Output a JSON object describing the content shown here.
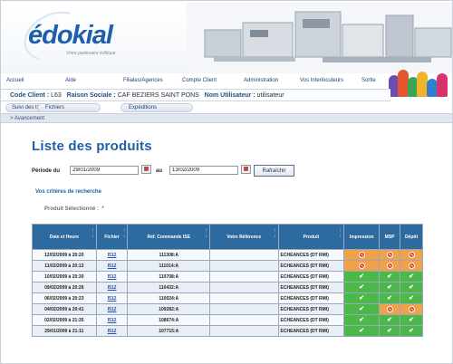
{
  "brand": {
    "logo": "édokial",
    "tagline": "Votre partenaire éditique",
    "accent": "#1f5ea8",
    "header_blue": "#2d6aa0",
    "ok_color": "#4db84a",
    "ko_color": "#f2a14b"
  },
  "menu": [
    "Accueil",
    "Aide",
    "Filiales/Agences",
    "Compte Client",
    "Administration",
    "Vos Interlocuteurs",
    "Sortie"
  ],
  "infobar": {
    "client_code_label": "Code Client :",
    "client_code": "L63",
    "company_label": "Raison Sociale :",
    "company": "CAF BEZIERS SAINT PONS",
    "user_label": "Nom Utilisateur :",
    "user": "utilisateur"
  },
  "subtabs": [
    "Suivi des travaux",
    "Fichiers",
    "Expéditions"
  ],
  "breadcrumb": "> Avancement",
  "page_title": "Liste des produits",
  "filter": {
    "period_label": "Période du",
    "from": "29/01/2009",
    "to_label": "au",
    "to": "13/02/2009",
    "refresh": "Rafraîchir"
  },
  "criteria_link": "Vos critères de recherche",
  "selected_label": "Produit Sélectionné :",
  "selected_value": "*",
  "table": {
    "headers": [
      "Date et Heure",
      "Fichier",
      "Réf. Commande ISE",
      "Votre Référence",
      "Produit",
      "Impression",
      "MSP",
      "Dépôt"
    ],
    "rows": [
      {
        "date": "12/02/2009 à 20:20",
        "file": "I512",
        "ref": "111308:A",
        "yours": "",
        "product": "ECHEANCES (DT RMI)",
        "status": [
          "ko",
          "ko",
          "ko"
        ]
      },
      {
        "date": "11/02/2009 à 20:13",
        "file": "I512",
        "ref": "111014:A",
        "yours": "",
        "product": "ECHEANCES (DT RMI)",
        "status": [
          "ko",
          "ko",
          "ko"
        ]
      },
      {
        "date": "10/02/2009 à 20:30",
        "file": "I512",
        "ref": "110708:A",
        "yours": "",
        "product": "ECHEANCES (DT RMI)",
        "status": [
          "ok",
          "ok",
          "ok"
        ]
      },
      {
        "date": "09/02/2009 à 20:26",
        "file": "I512",
        "ref": "110432:A",
        "yours": "",
        "product": "ECHEANCES (DT RMI)",
        "status": [
          "ok",
          "ok",
          "ok"
        ]
      },
      {
        "date": "06/02/2009 à 20:23",
        "file": "I512",
        "ref": "110024:A",
        "yours": "",
        "product": "ECHEANCES (DT RMI)",
        "status": [
          "ok",
          "ok",
          "ok"
        ]
      },
      {
        "date": "04/02/2009 à 20:41",
        "file": "I512",
        "ref": "109282:A",
        "yours": "",
        "product": "ECHEANCES (DT RMI)",
        "status": [
          "ok",
          "ko",
          "ko"
        ]
      },
      {
        "date": "02/02/2009 à 21:35",
        "file": "I512",
        "ref": "108674:A",
        "yours": "",
        "product": "ECHEANCES (DT RMI)",
        "status": [
          "ok",
          "ok",
          "ok"
        ]
      },
      {
        "date": "29/01/2009 à 21:11",
        "file": "I512",
        "ref": "107715:A",
        "yours": "",
        "product": "ECHEANCES (DT RMI)",
        "status": [
          "ok",
          "ok",
          "ok"
        ]
      }
    ]
  }
}
